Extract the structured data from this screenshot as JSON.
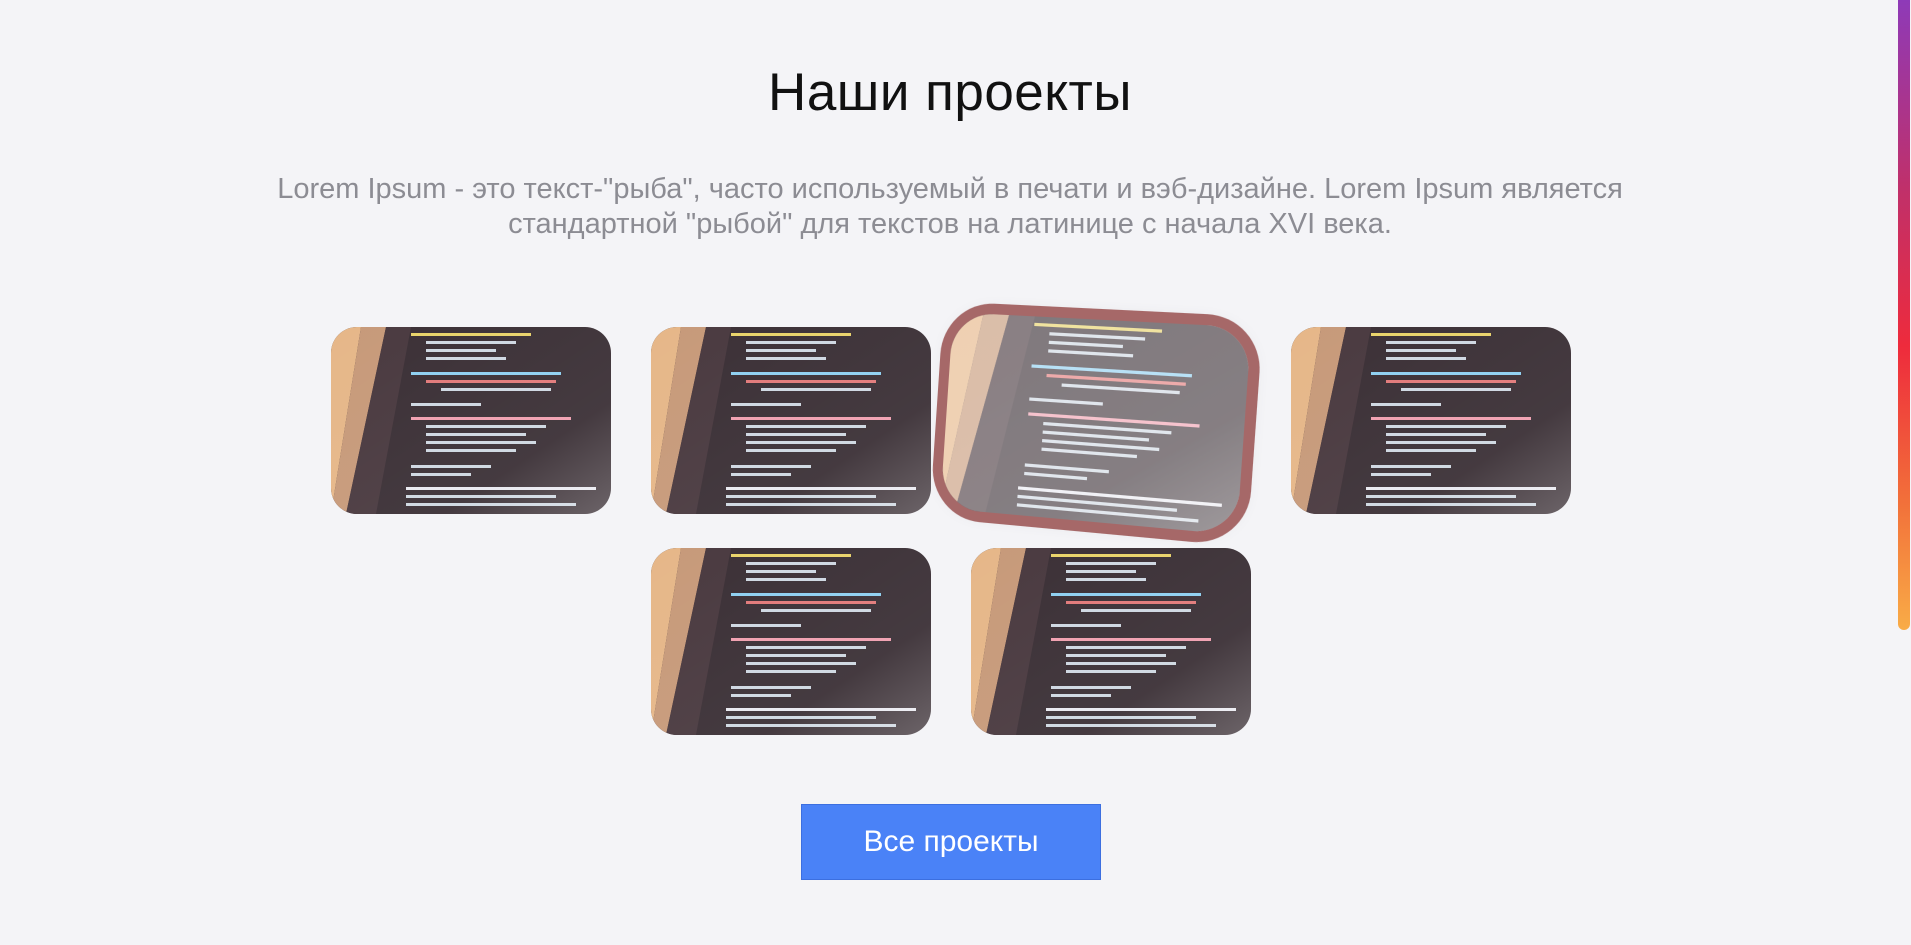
{
  "section": {
    "title": "Наши проекты",
    "description": "Lorem Ipsum - это текст-\"рыба\", часто используемый в печати и вэб-дизайне. Lorem Ipsum является стандартной \"рыбой\" для текстов на латинице с начала XVI века."
  },
  "projects": {
    "image_icon": "code-screen-photo",
    "active_index": 2
  },
  "cta": {
    "label": "Все проекты"
  }
}
